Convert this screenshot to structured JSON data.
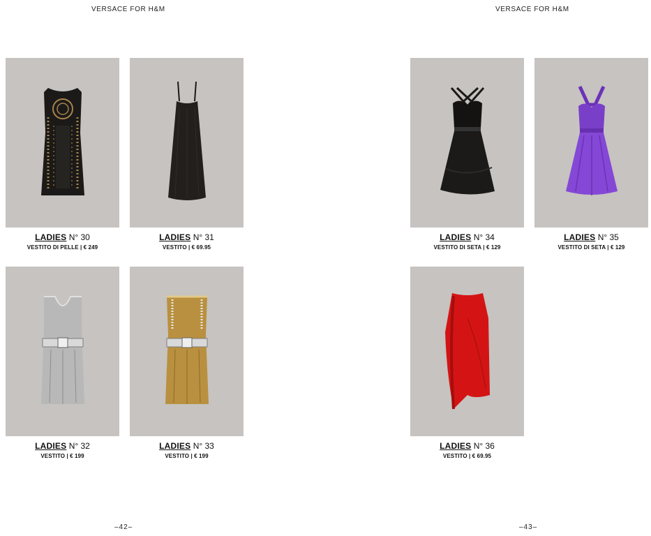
{
  "left_page": {
    "header": "VERSACE FOR H&M",
    "page_number": "–42–",
    "items": [
      {
        "ladies": "LADIES",
        "number": "N° 30",
        "description": "VESTITO DI PELLE | € 249"
      },
      {
        "ladies": "LADIES",
        "number": "N° 31",
        "description": "VESTITO | € 69.95"
      },
      {
        "ladies": "LADIES",
        "number": "N° 32",
        "description": "VESTITO | € 199"
      },
      {
        "ladies": "LADIES",
        "number": "N° 33",
        "description": "VESTITO | € 199"
      }
    ]
  },
  "right_page": {
    "header": "VERSACE FOR H&M",
    "page_number": "–43–",
    "items": [
      {
        "ladies": "LADIES",
        "number": "N° 34",
        "description": "VESTITO DI SETA | € 129"
      },
      {
        "ladies": "LADIES",
        "number": "N° 35",
        "description": "VESTITO DI SETA | € 129"
      },
      {
        "ladies": "LADIES",
        "number": "N° 36",
        "description": "VESTITO | € 69.95"
      }
    ]
  },
  "colors": {
    "photo_background": "#c6c3c0",
    "black_leather": "#1b1a19",
    "stud_gold": "#a8844a",
    "silver": "#b8b8b8",
    "gold": "#b9903f",
    "purple": "#7a3fc9",
    "red": "#d41414"
  }
}
